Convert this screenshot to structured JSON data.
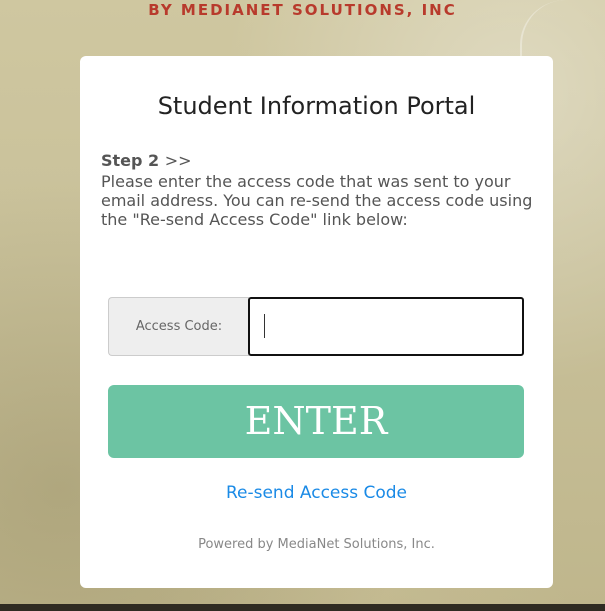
{
  "brand_banner": "BY MEDIANET SOLUTIONS, INC",
  "card": {
    "title": "Student Information Portal",
    "step_label": "Step 2",
    "step_arrows": ">>",
    "instructions": "Please enter the access code that was sent to your email address. You can re-send the access code using the \"Re-send Access Code\" link below:",
    "access_code": {
      "label": "Access Code:",
      "value": ""
    },
    "enter_button_label": "ENTER",
    "resend_link_label": "Re-send Access Code",
    "powered_by": "Powered by MediaNet Solutions, Inc."
  },
  "colors": {
    "brand_red": "#b83a2c",
    "button_green": "#6cc4a3",
    "link_blue": "#1a8ae6"
  },
  "icons": {
    "text_caret": "text-caret-icon"
  }
}
